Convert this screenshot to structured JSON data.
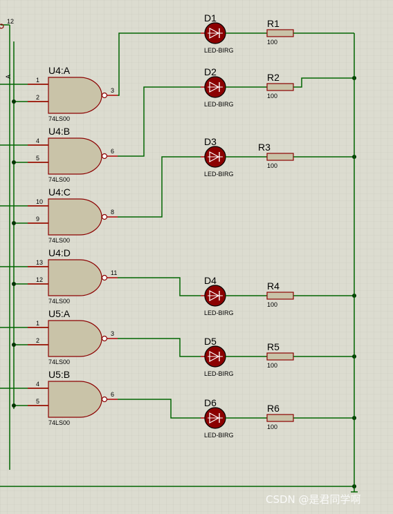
{
  "schematic": {
    "gates": [
      {
        "ref": "U4:A",
        "part": "74LS00",
        "in_a": "1",
        "in_b": "2",
        "out": "3"
      },
      {
        "ref": "U4:B",
        "part": "74LS00",
        "in_a": "4",
        "in_b": "5",
        "out": "6"
      },
      {
        "ref": "U4:C",
        "part": "74LS00",
        "in_a": "10",
        "in_b": "9",
        "out": "8"
      },
      {
        "ref": "U4:D",
        "part": "74LS00",
        "in_a": "13",
        "in_b": "12",
        "out": "11"
      },
      {
        "ref": "U5:A",
        "part": "74LS00",
        "in_a": "1",
        "in_b": "2",
        "out": "3"
      },
      {
        "ref": "U5:B",
        "part": "74LS00",
        "in_a": "4",
        "in_b": "5",
        "out": "6"
      }
    ],
    "leds": [
      {
        "ref": "D1",
        "part": "LED-BIRG"
      },
      {
        "ref": "D2",
        "part": "LED-BIRG"
      },
      {
        "ref": "D3",
        "part": "LED-BIRG"
      },
      {
        "ref": "D4",
        "part": "LED-BIRG"
      },
      {
        "ref": "D5",
        "part": "LED-BIRG"
      },
      {
        "ref": "D6",
        "part": "LED-BIRG"
      }
    ],
    "resistors": [
      {
        "ref": "R1",
        "value": "100"
      },
      {
        "ref": "R2",
        "value": "100"
      },
      {
        "ref": "R3",
        "value": "100"
      },
      {
        "ref": "R4",
        "value": "100"
      },
      {
        "ref": "R5",
        "value": "100"
      },
      {
        "ref": "R6",
        "value": "100"
      }
    ],
    "top_pin": "12",
    "side_label": "A"
  },
  "watermark": "CSDN @是君同学啊",
  "colors": {
    "background": "#dcdcd0",
    "grid": "#c6c6b8",
    "wire": "#006400",
    "gate_fill": "#c9c3a8",
    "gate_stroke": "#8b0000",
    "led_fill": "#8b0000",
    "resistor_fill": "#c9c3a8",
    "pin_line": "#b00000",
    "junction": "#003300"
  }
}
